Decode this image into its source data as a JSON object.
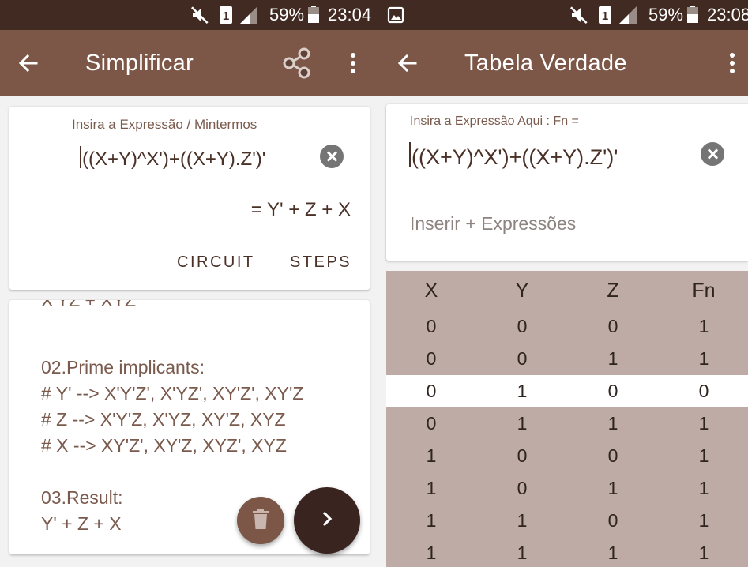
{
  "status_bar": {
    "left": {
      "battery": "59%",
      "time": "23:04",
      "sim": "1"
    },
    "right": {
      "battery": "59%",
      "time": "23:08",
      "sim": "1"
    }
  },
  "left_screen": {
    "title": "Simplificar",
    "input_label": "Insira a Expressão / Mintermos",
    "expression": "((X+Y)^X')+((X+Y).Z')'",
    "result": "= Y' + Z + X",
    "circuit_button": "CIRCUIT",
    "steps_button": "STEPS",
    "steps": {
      "cut_line": "X'YZ + XYZ",
      "section2_title": "02.Prime implicants:",
      "section2_lines": [
        "# Y' --> X'Y'Z', X'YZ', XY'Z', XY'Z",
        "# Z --> X'Y'Z, X'YZ, XY'Z, XYZ",
        "# X --> XY'Z', XY'Z, XYZ', XYZ"
      ],
      "section3_title": "03.Result:",
      "section3_value": "Y' + Z + X"
    }
  },
  "right_screen": {
    "title": "Tabela Verdade",
    "input_label": "Insira a Expressão Aqui : Fn =",
    "expression": "((X+Y)^X')+((X+Y).Z')'",
    "add_expressions": "Inserir + Expressões",
    "table": {
      "headers": [
        "X",
        "Y",
        "Z",
        "Fn"
      ],
      "rows": [
        [
          "0",
          "0",
          "0",
          "1"
        ],
        [
          "0",
          "0",
          "1",
          "1"
        ],
        [
          "0",
          "1",
          "0",
          "0"
        ],
        [
          "0",
          "1",
          "1",
          "1"
        ],
        [
          "1",
          "0",
          "0",
          "1"
        ],
        [
          "1",
          "0",
          "1",
          "1"
        ],
        [
          "1",
          "1",
          "0",
          "1"
        ],
        [
          "1",
          "1",
          "1",
          "1"
        ]
      ],
      "selected_row": 2
    }
  },
  "colors": {
    "status_bar": "#412a22",
    "app_bar": "#7c5747",
    "text_brown": "#4a3128",
    "label_brown": "#7a5a4d",
    "table_bg": "#bfaba5",
    "fab_dark": "#3a2420",
    "fab_light": "#7c5747"
  },
  "icons": [
    "back-arrow-icon",
    "share-icon",
    "more-vert-icon",
    "mute-icon",
    "signal-icon",
    "battery-icon",
    "image-notification-icon",
    "clear-icon",
    "delete-icon",
    "chevron-right-icon"
  ]
}
